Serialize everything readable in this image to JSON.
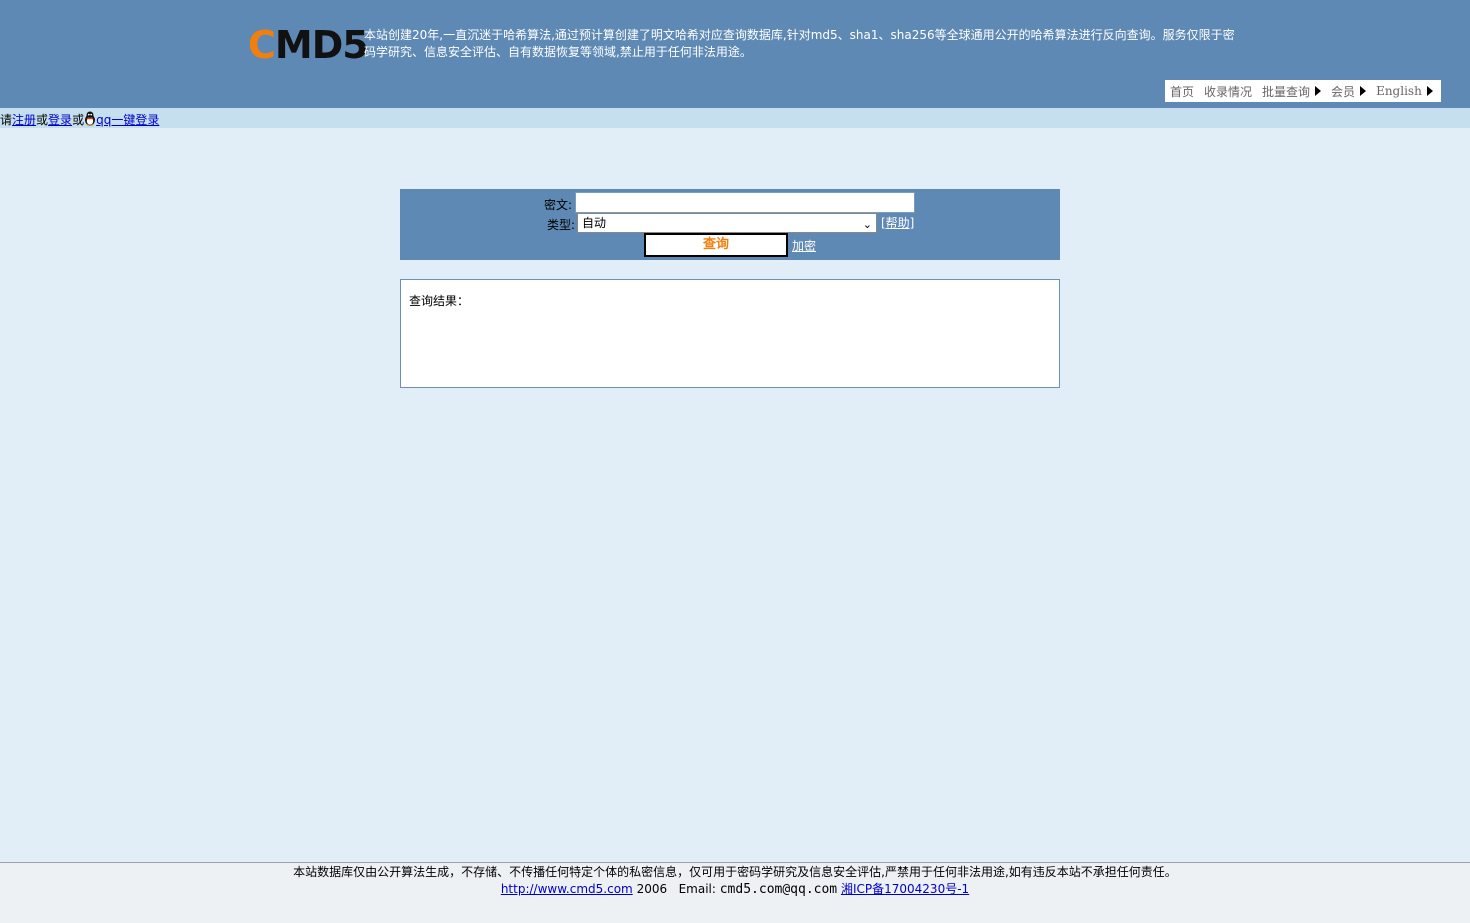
{
  "header": {
    "logo_first": "C",
    "logo_rest": "MD5",
    "intro": "本站创建20年,一直沉迷于哈希算法,通过预计算创建了明文哈希对应查询数据库,针对md5、sha1、sha256等全球通用公开的哈希算法进行反向查询。服务仅限于密码学研究、信息安全评估、自有数据恢复等领域,禁止用于任何非法用途。",
    "brand_color": "#5e89b4",
    "logo_accent": "#f07f0e"
  },
  "nav": {
    "items": [
      {
        "label": "首页",
        "has_arrow": false
      },
      {
        "label": "收录情况",
        "has_arrow": false
      },
      {
        "label": "批量查询",
        "has_arrow": true
      },
      {
        "label": "会员",
        "has_arrow": true
      },
      {
        "label": "English",
        "has_arrow": true
      }
    ]
  },
  "login": {
    "prefix": "请",
    "register": "注册",
    "or1": "或",
    "login": "登录",
    "or2": "或",
    "qq_login": "qq一键登录",
    "qq_icon": "qq-penguin-icon"
  },
  "search": {
    "cipher_label": "密文:",
    "cipher_value": "",
    "type_label": "类型:",
    "type_selected": "自动",
    "help_link": "[帮助]",
    "query_button": "查询",
    "encrypt_link": "加密"
  },
  "result": {
    "label": "查询结果："
  },
  "footer": {
    "disclaimer": "本站数据库仅由公开算法生成，不存储、不传播任何特定个体的私密信息，仅可用于密码学研究及信息安全评估,严禁用于任何非法用途,如有违反本站不承担任何责任。",
    "site_link": "http://www.cmd5.com",
    "year": "2006",
    "email_label": "Email:",
    "email": "cmd5.com@qq.com",
    "icp": "湘ICP备17004230号-1"
  }
}
